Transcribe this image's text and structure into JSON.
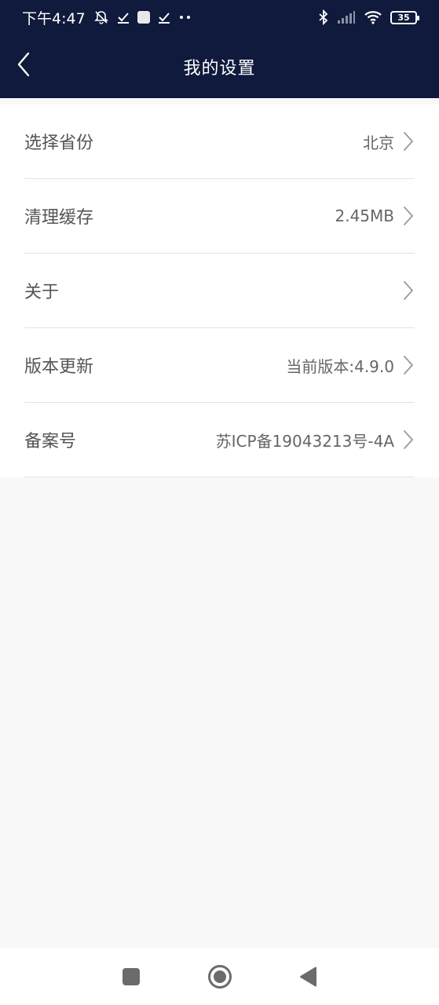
{
  "status_bar": {
    "time": "下午4:47",
    "battery": "35",
    "colors": {
      "background": "#0f1a3c",
      "foreground": "#ffffff"
    },
    "icons": [
      "mute-bell-icon",
      "download-check-icon",
      "app-square-icon",
      "download-check-icon",
      "more-dots-icon",
      "bluetooth-icon",
      "signal-icon",
      "wifi-icon",
      "battery-icon"
    ]
  },
  "header": {
    "title": "我的设置",
    "back_icon": "back-arrow-icon"
  },
  "settings": {
    "items": [
      {
        "label": "选择省份",
        "value": "北京"
      },
      {
        "label": "清理缓存",
        "value": "2.45MB"
      },
      {
        "label": "关于",
        "value": ""
      },
      {
        "label": "版本更新",
        "value": "当前版本:4.9.0"
      },
      {
        "label": "备案号",
        "value": "苏ICP备19043213号-4A"
      }
    ]
  },
  "system_nav": {
    "icons": [
      "recents-square-icon",
      "home-circle-icon",
      "back-triangle-icon"
    ]
  },
  "colors": {
    "header_bg": "#0f1a3c",
    "page_bg": "#f8f8f8",
    "card_bg": "#ffffff",
    "label_text": "#555555",
    "value_text": "#666666",
    "divider": "#e3e3e3"
  }
}
